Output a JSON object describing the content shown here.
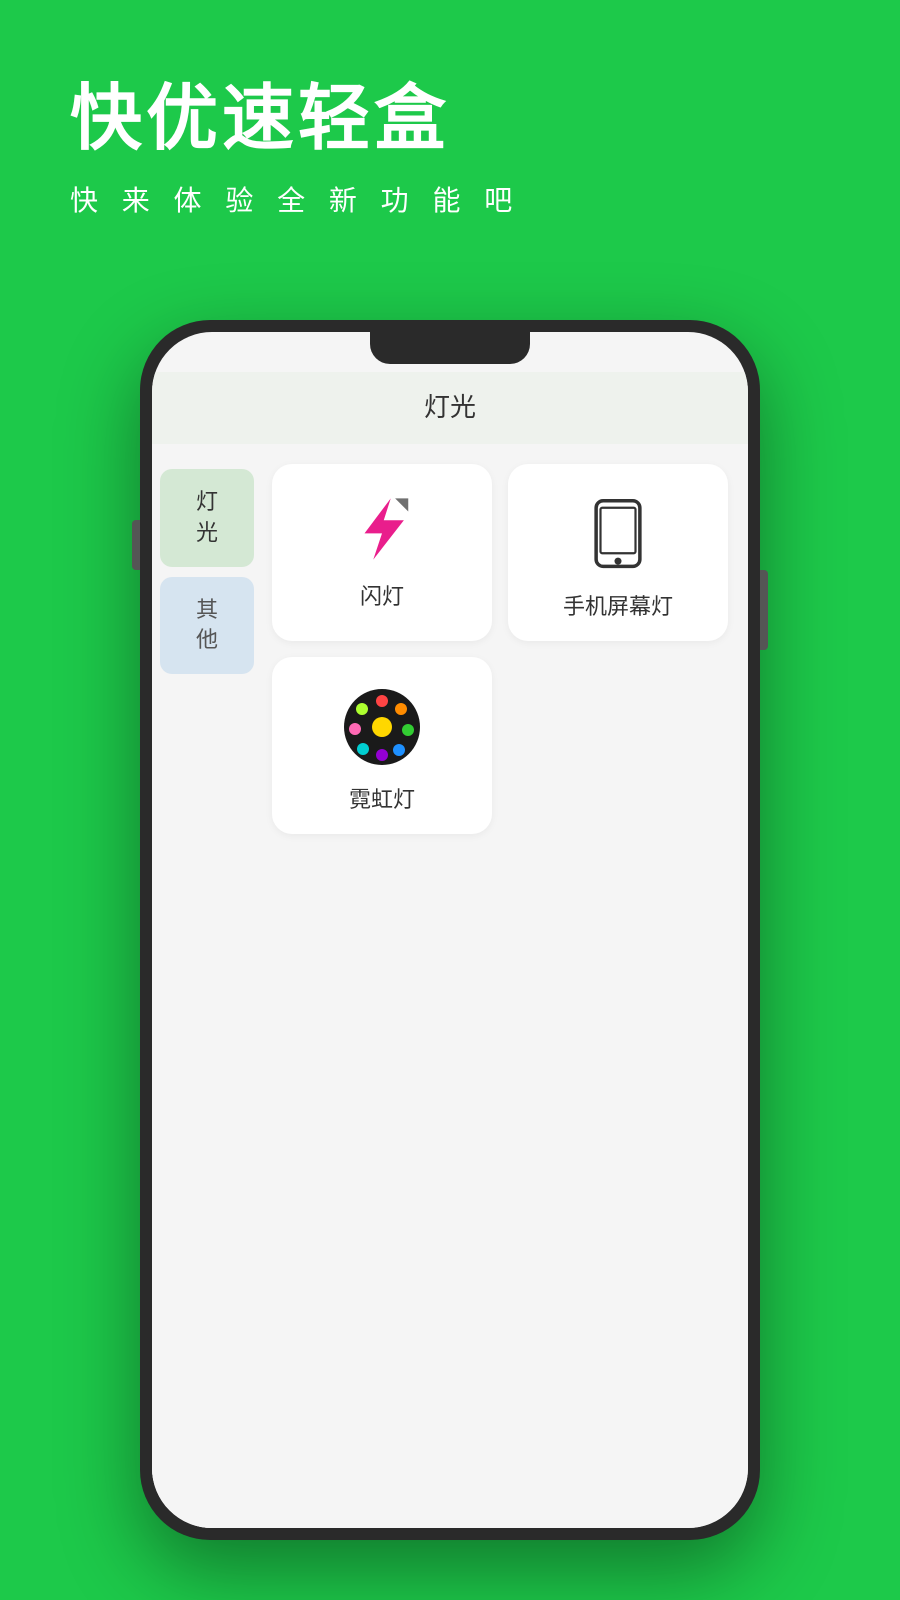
{
  "background_color": "#1DC94A",
  "header": {
    "title": "快优速轻盒",
    "subtitle": "快 来 体 验 全 新 功 能 吧"
  },
  "phone": {
    "screen_title": "灯光",
    "sidebar": [
      {
        "label": "灯\n光",
        "active": true,
        "style": "active"
      },
      {
        "label": "其\n他",
        "active": false,
        "style": "other"
      }
    ],
    "grid_items": [
      {
        "id": "flash",
        "label": "闪灯",
        "icon": "flash-icon"
      },
      {
        "id": "phone-screen",
        "label": "手机屏幕灯",
        "icon": "phone-icon"
      },
      {
        "id": "neon",
        "label": "霓虹灯",
        "icon": "neon-icon"
      }
    ]
  }
}
